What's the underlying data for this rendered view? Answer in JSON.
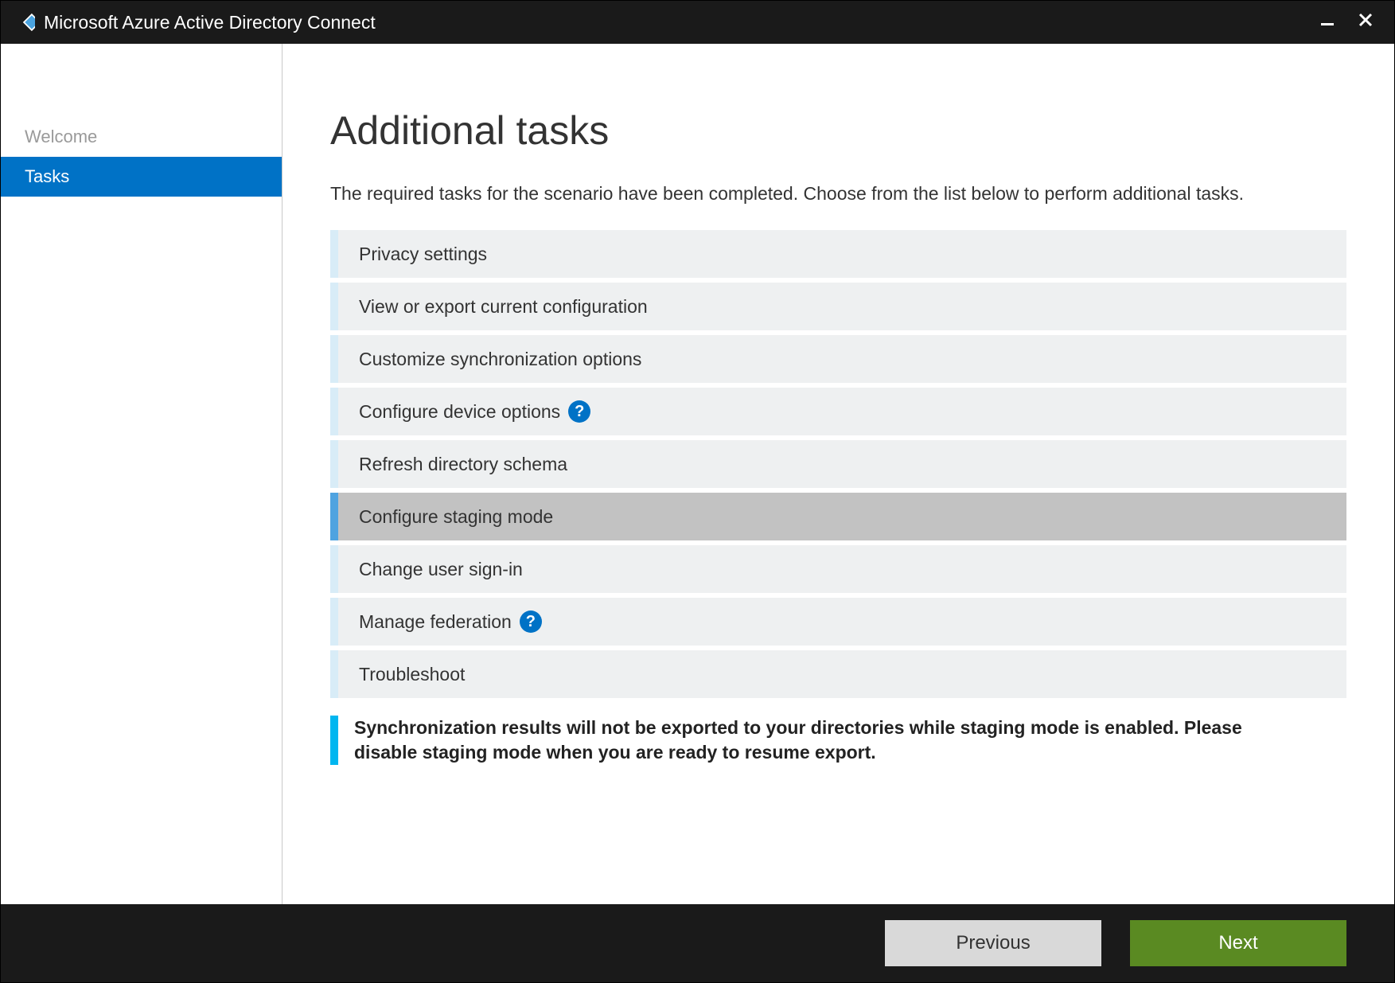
{
  "titlebar": {
    "app_title": "Microsoft Azure Active Directory Connect"
  },
  "sidebar": {
    "steps": [
      {
        "label": "Welcome",
        "active": false
      },
      {
        "label": "Tasks",
        "active": true
      }
    ]
  },
  "main": {
    "heading": "Additional tasks",
    "intro": "The required tasks for the scenario have been completed. Choose from the list below to perform additional tasks.",
    "tasks": [
      {
        "label": "Privacy settings",
        "help": false,
        "selected": false
      },
      {
        "label": "View or export current configuration",
        "help": false,
        "selected": false
      },
      {
        "label": "Customize synchronization options",
        "help": false,
        "selected": false
      },
      {
        "label": "Configure device options",
        "help": true,
        "selected": false
      },
      {
        "label": "Refresh directory schema",
        "help": false,
        "selected": false
      },
      {
        "label": "Configure staging mode",
        "help": false,
        "selected": true
      },
      {
        "label": "Change user sign-in",
        "help": false,
        "selected": false
      },
      {
        "label": "Manage federation",
        "help": true,
        "selected": false
      },
      {
        "label": "Troubleshoot",
        "help": false,
        "selected": false
      }
    ],
    "notice": "Synchronization results will not be exported to your directories while staging mode is enabled. Please disable staging mode when you are ready to resume export."
  },
  "footer": {
    "previous_label": "Previous",
    "next_label": "Next"
  },
  "help_glyph": "?"
}
